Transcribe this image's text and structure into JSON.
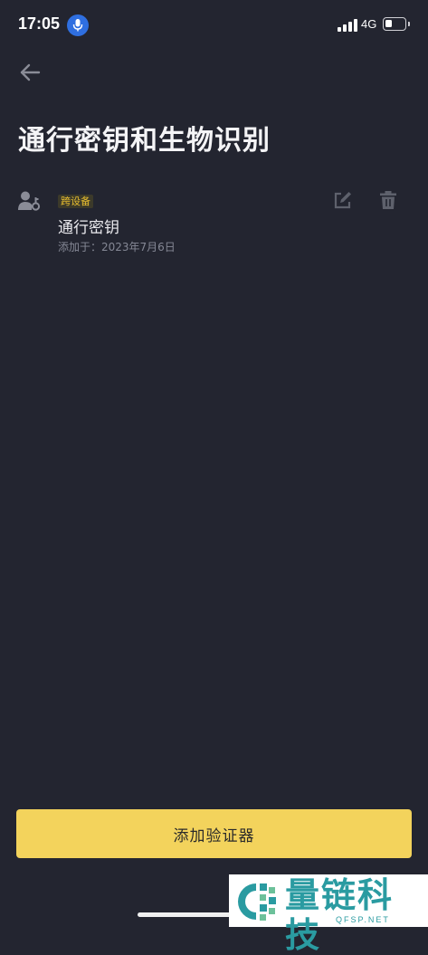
{
  "status_bar": {
    "time": "17:05",
    "network": "4G",
    "battery_level": 0.35
  },
  "header": {
    "title": "通行密钥和生物识别"
  },
  "passkeys": [
    {
      "tag": "跨设备",
      "name": "通行密钥",
      "added": "添加于：2023年7月6日"
    }
  ],
  "footer": {
    "add_button_label": "添加验证器"
  },
  "watermark": {
    "brand": "量链科技",
    "site": "QFSP.NET"
  },
  "colors": {
    "background": "#232530",
    "accent": "#f3d35c",
    "tag_text": "#e8bd2f",
    "watermark": "#2a9ba1"
  }
}
